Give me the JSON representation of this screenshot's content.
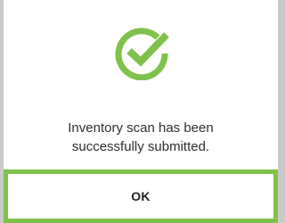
{
  "dialog": {
    "icon": "check-circle-icon",
    "accent_color": "#7fc24b",
    "message_line1": "Inventory scan has been",
    "message_line2": "successfully submitted.",
    "ok_label": "OK"
  }
}
